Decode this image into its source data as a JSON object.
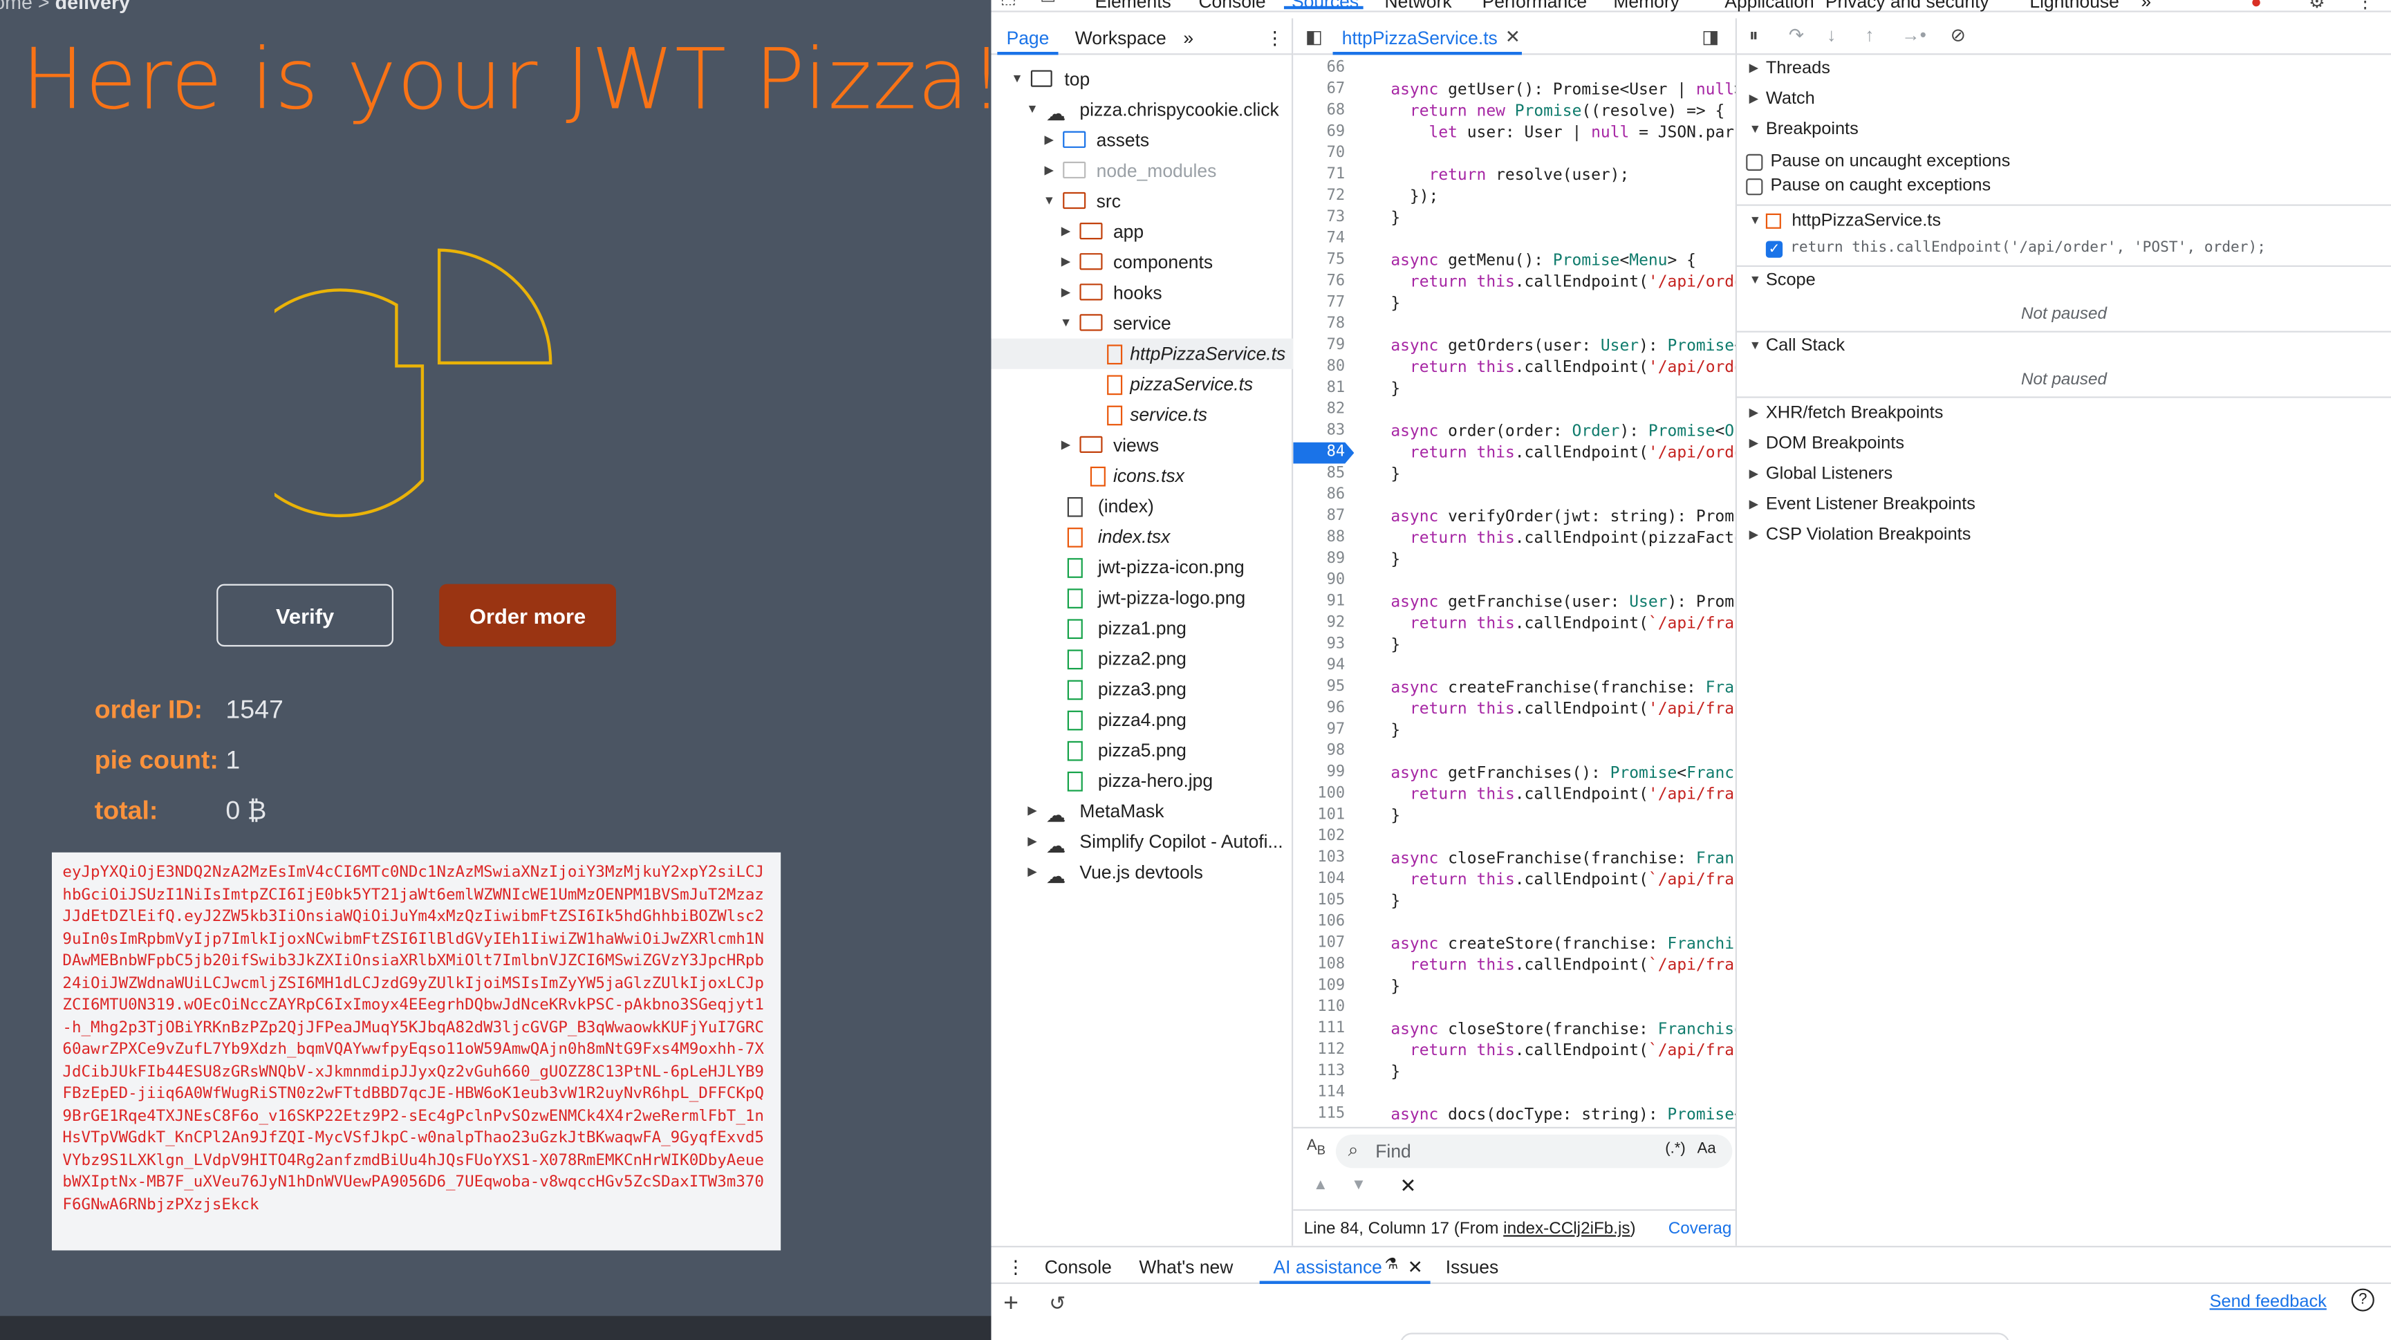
{
  "app": {
    "breadcrumb_prefix": "ome >",
    "breadcrumb_current": "delivery",
    "headline": "Here is your JWT Pizza!",
    "verify_label": "Verify",
    "order_more_label": "Order more",
    "order_id_label": "order ID:",
    "order_id_value": "1547",
    "pie_count_label": "pie count:",
    "pie_count_value": "1",
    "total_label": "total:",
    "total_value": "0 ₿",
    "jwt": "eyJpYXQiOjE3NDQ2NzA2MzEsImV4cCI6MTc0NDc1NzAzMSwiaXNzIjoiY3MzMjkuY2xpY2siLCJhbGciOiJSUzI1NiIsImtpZCI6IjE0bk5YT21jaWt6emlWZWNIcWE1UmMzOENPM1BVSmJuT2MzazJJdEtDZlEifQ.eyJ2ZW5kb3IiOnsiaWQiOiJuYm4xMzQzIiwibmFtZSI6Ik5hdGhhbiBOZWlsc29uIn0sImRpbmVyIjp7ImlkIjoxNCwibmFtZSI6IlBldGVyIEh1IiwiZW1haWwiOiJwZXRlcmh1NDAwMEBnbWFpbC5jb20ifSwib3JkZXIiOnsiaXRlbXMiOlt7ImlbnVJZCI6MSwiZGVzY3JpcHRpb24iOiJWZWdnaWUiLCJwcmljZSI6MH1dLCJzdG9yZUlkIjoiMSIsImZyYW5jaGlzZUlkIjoxLCJpZCI6MTU0N319.wOEcOiNccZAYRpC6IxImoyx4EEegrhDQbwJdNceKRvkPSC-pAkbno3SGeqjyt1-h_Mhg2p3TjOBiYRKnBzPZp2QjJFPeaJMuqY5KJbqA82dW3ljcGVGP_B3qWwaowkKUFjYuI7GRC60awrZPXCe9vZufL7Yb9Xdzh_bqmVQAYwwfpyEqso11oW59AmwQAjn0h8mNtG9Fxs4M9oxhh-7XJdCibJUkFIb44ESU8zGRsWNQbV-xJkmnmdipJJyxQz2vGuh660_gUOZZ8C13PtNL-6pLeHJLYB9FBzEpED-jiiq6A0WfWugRiSTN0z2wFTtdBBD7qcJE-HBW6oK1eub3vW1R2uyNvR6hpL_DFFCKpQ9BrGE1Rqe4TXJNEsC8F6o_v16SKP22Etz9P2-sEc4gPclnPvSOzwENMCk4X4r2weRermlFbT_1nHsVTpVWGdkT_KnCPl2An9JfZQI-MycVSfJkpC-w0nalpThao23uGzkJtBKwaqwFA_9GyqfExvd5VYbz9S1LXKlgn_LVdpV9HITO4Rg2anfzmdBiUu4hJQsFUoYXS1-X078RmEMKCnHrWIK0DbyAeuebWXIptNx-MB7F_uXVeu76JyN1hDnWVUewPA9056D6_7UEqwoba-v8wqccHGv5ZcSDaxITW3m370F6GNwA6RNbjzPXzjsEkck"
  },
  "devtools": {
    "top_tabs": [
      "Elements",
      "Console",
      "Sources",
      "Network",
      "Performance",
      "Memory",
      "Application",
      "Privacy and security",
      "Lighthouse",
      "»"
    ],
    "sub_tabs": [
      "Page",
      "Workspace",
      "»"
    ],
    "tree": [
      {
        "label": "top",
        "icon": "frame"
      },
      {
        "label": "pizza.chrispycookie.click",
        "icon": "cloud"
      },
      {
        "label": "assets",
        "icon": "folder-blue"
      },
      {
        "label": "node_modules",
        "icon": "folder-gray"
      },
      {
        "label": "src",
        "icon": "folder"
      },
      {
        "label": "app",
        "icon": "folder"
      },
      {
        "label": "components",
        "icon": "folder"
      },
      {
        "label": "hooks",
        "icon": "folder"
      },
      {
        "label": "service",
        "icon": "folder"
      },
      {
        "label": "httpPizzaService.ts",
        "icon": "file-ts"
      },
      {
        "label": "pizzaService.ts",
        "icon": "file-ts"
      },
      {
        "label": "service.ts",
        "icon": "file-ts"
      },
      {
        "label": "views",
        "icon": "folder"
      },
      {
        "label": "icons.tsx",
        "icon": "file-ts"
      },
      {
        "label": "(index)",
        "icon": "file"
      },
      {
        "label": "index.tsx",
        "icon": "file-ts"
      },
      {
        "label": "jwt-pizza-icon.png",
        "icon": "file-img"
      },
      {
        "label": "jwt-pizza-logo.png",
        "icon": "file-img"
      },
      {
        "label": "pizza1.png",
        "icon": "file-img"
      },
      {
        "label": "pizza2.png",
        "icon": "file-img"
      },
      {
        "label": "pizza3.png",
        "icon": "file-img"
      },
      {
        "label": "pizza4.png",
        "icon": "file-img"
      },
      {
        "label": "pizza5.png",
        "icon": "file-img"
      },
      {
        "label": "pizza-hero.jpg",
        "icon": "file-img"
      },
      {
        "label": "MetaMask",
        "icon": "cloud"
      },
      {
        "label": "Simplify Copilot - Autofi...",
        "icon": "cloud"
      },
      {
        "label": "Vue.js devtools",
        "icon": "cloud"
      }
    ],
    "editor_tab": "httpPizzaService.ts",
    "code": [
      {
        "n": "66",
        "t": ""
      },
      {
        "n": "67",
        "t": "async getUser(): Promise<User | null>"
      },
      {
        "n": "68",
        "t": "  return new Promise((resolve) => {"
      },
      {
        "n": "69",
        "t": "    let user: User | null = JSON.parse"
      },
      {
        "n": "70",
        "t": ""
      },
      {
        "n": "71",
        "t": "    return resolve(user);"
      },
      {
        "n": "72",
        "t": "  });"
      },
      {
        "n": "73",
        "t": "}"
      },
      {
        "n": "74",
        "t": ""
      },
      {
        "n": "75",
        "t": "async getMenu(): Promise<Menu> {"
      },
      {
        "n": "76",
        "t": "  return this.callEndpoint('/api/order"
      },
      {
        "n": "77",
        "t": "}"
      },
      {
        "n": "78",
        "t": ""
      },
      {
        "n": "79",
        "t": "async getOrders(user: User): Promise<O"
      },
      {
        "n": "80",
        "t": "  return this.callEndpoint('/api/order"
      },
      {
        "n": "81",
        "t": "}"
      },
      {
        "n": "82",
        "t": ""
      },
      {
        "n": "83",
        "t": "async order(order: Order): Promise<Ord"
      },
      {
        "n": "84",
        "t": "  return this.callEndpoint('/api/order"
      },
      {
        "n": "85",
        "t": "}"
      },
      {
        "n": "86",
        "t": ""
      },
      {
        "n": "87",
        "t": "async verifyOrder(jwt: string): Promis"
      },
      {
        "n": "88",
        "t": "  return this.callEndpoint(pizzaFactor"
      },
      {
        "n": "89",
        "t": "}"
      },
      {
        "n": "90",
        "t": ""
      },
      {
        "n": "91",
        "t": "async getFranchise(user: User): Promis"
      },
      {
        "n": "92",
        "t": "  return this.callEndpoint(`/api/franc"
      },
      {
        "n": "93",
        "t": "}"
      },
      {
        "n": "94",
        "t": ""
      },
      {
        "n": "95",
        "t": "async createFranchise(franchise: Franc"
      },
      {
        "n": "96",
        "t": "  return this.callEndpoint('/api/franc"
      },
      {
        "n": "97",
        "t": "}"
      },
      {
        "n": "98",
        "t": ""
      },
      {
        "n": "99",
        "t": "async getFranchises(): Promise<Franchi"
      },
      {
        "n": "100",
        "t": "  return this.callEndpoint('/api/franc"
      },
      {
        "n": "101",
        "t": "}"
      },
      {
        "n": "102",
        "t": ""
      },
      {
        "n": "103",
        "t": "async closeFranchise(franchise: Franch"
      },
      {
        "n": "104",
        "t": "  return this.callEndpoint(`/api/franc"
      },
      {
        "n": "105",
        "t": "}"
      },
      {
        "n": "106",
        "t": ""
      },
      {
        "n": "107",
        "t": "async createStore(franchise: Franchise"
      },
      {
        "n": "108",
        "t": "  return this.callEndpoint(`/api/franc"
      },
      {
        "n": "109",
        "t": "}"
      },
      {
        "n": "110",
        "t": ""
      },
      {
        "n": "111",
        "t": "async closeStore(franchise: Franchise,"
      },
      {
        "n": "112",
        "t": "  return this.callEndpoint(`/api/franc"
      },
      {
        "n": "113",
        "t": "}"
      },
      {
        "n": "114",
        "t": ""
      },
      {
        "n": "115",
        "t": "async docs(docType: string): Promise<E"
      }
    ],
    "breakpoint_line": "84",
    "find_placeholder": "Find",
    "find_regex": "(.*)",
    "find_case": "Aa",
    "status_text": "Line 84, Column 17 (From",
    "status_link": "index-CClj2iFb.js",
    "status_close": ")",
    "coverage": "Coverag",
    "right": {
      "threads": "Threads",
      "watch": "Watch",
      "breakpoints": "Breakpoints",
      "pause_uncaught": "Pause on uncaught exceptions",
      "pause_caught": "Pause on caught exceptions",
      "bp_file": "httpPizzaService.ts",
      "bp_code": "return this.callEndpoint('/api/order', 'POST', order);",
      "scope": "Scope",
      "not_paused_1": "Not paused",
      "call_stack": "Call Stack",
      "not_paused_2": "Not paused",
      "xhr": "XHR/fetch Breakpoints",
      "dom": "DOM Breakpoints",
      "global": "Global Listeners",
      "event": "Event Listener Breakpoints",
      "csp": "CSP Violation Breakpoints"
    },
    "drawer_tabs": [
      "Console",
      "What's new",
      "AI assistance",
      "Issues"
    ],
    "send_feedback": "Send feedback"
  },
  "colors": {
    "accent": "#1a73e8",
    "brand_orange": "#f97316",
    "order_button": "#9a3412",
    "app_bg": "#4b5563"
  }
}
